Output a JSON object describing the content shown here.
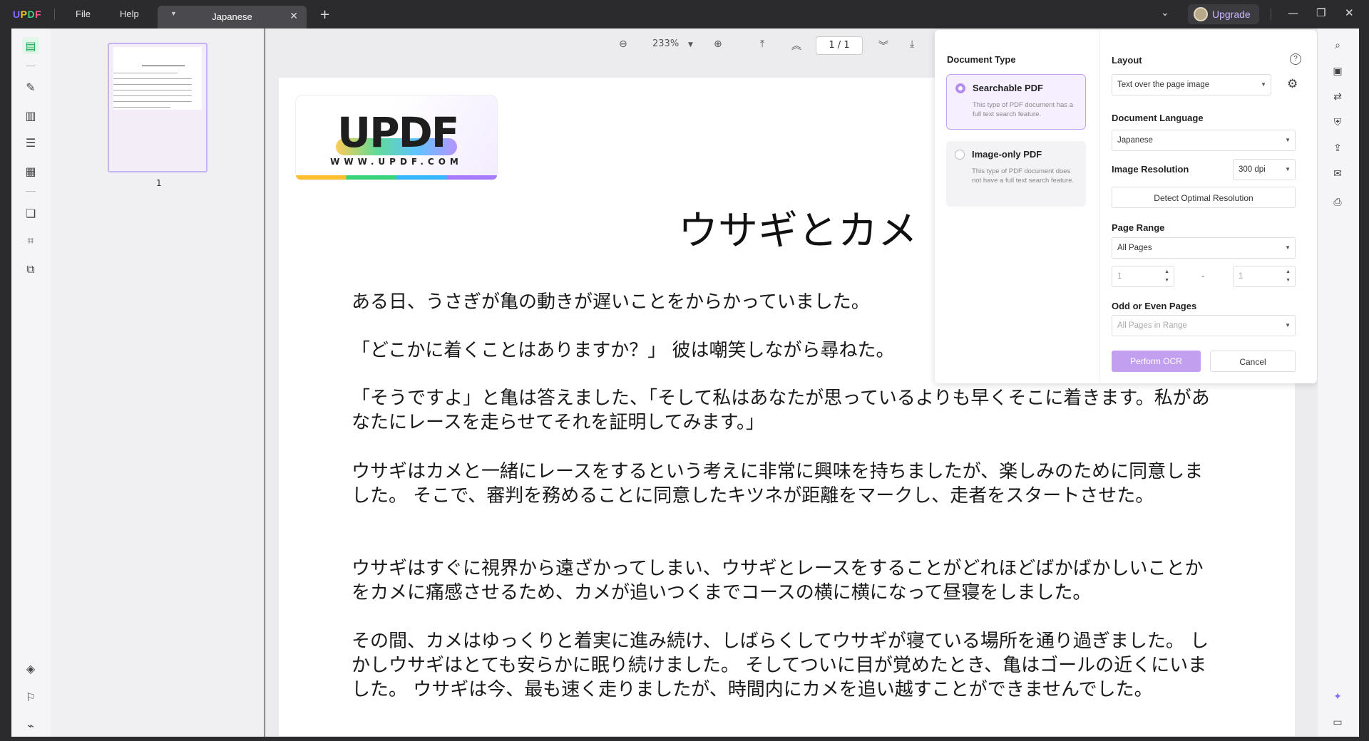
{
  "app": {
    "menu": {
      "file": "File",
      "help": "Help"
    },
    "tab": {
      "title": "Japanese"
    },
    "upgrade_label": "Upgrade"
  },
  "thumbnails": [
    {
      "page_label": "1"
    }
  ],
  "toolbar": {
    "zoom": "233%",
    "page_indicator": "1 / 1"
  },
  "document": {
    "logo_text": "UPDF",
    "logo_url_text": "WWW.UPDF.COM",
    "title": "ウサギとカメ",
    "paragraphs": [
      "ある日、うさぎが亀の動きが遅いことをからかっていました。",
      "「どこかに着くことはありますか？」 彼は嘲笑しながら尋ねた。",
      "「そうですよ」と亀は答えました、「そして私はあなたが思っているよりも早くそこに着きます。私があなたにレースを走らせてそれを証明してみます。」",
      "ウサギはカメと一緒にレースをするという考えに非常に興味を持ちましたが、楽しみのために同意しました。 そこで、審判を務めることに同意したキツネが距離をマークし、走者をスタートさせた。",
      "ウサギはすぐに視界から遠ざかってしまい、ウサギとレースをすることがどれほどばかばかしいことかをカメに痛感させるため、カメが追いつくまでコースの横に横になって昼寝をしました。",
      "その間、カメはゆっくりと着実に進み続け、しばらくしてウサギが寝ている場所を通り過ぎました。 しかしウサギはとても安らかに眠り続けました。 そしてついに目が覚めたとき、亀はゴールの近くにいました。 ウサギは今、最も速く走りましたが、時間内にカメを追い越すことができませんでした。"
    ]
  },
  "ocr_panel": {
    "document_type_heading": "Document Type",
    "options": [
      {
        "title": "Searchable PDF",
        "description": "This type of PDF document has a full text search feature.",
        "selected": true
      },
      {
        "title": "Image-only PDF",
        "description": "This type of PDF document does not have a full text search feature.",
        "selected": false
      }
    ],
    "layout_heading": "Layout",
    "layout_value": "Text over the page image",
    "language_heading": "Document Language",
    "language_value": "Japanese",
    "resolution_heading": "Image Resolution",
    "resolution_value": "300 dpi",
    "detect_button": "Detect Optimal Resolution",
    "page_range_heading": "Page Range",
    "page_range_value": "All Pages",
    "range_from": "1",
    "range_to": "1",
    "range_dash": "-",
    "odd_even_heading": "Odd or Even Pages",
    "odd_even_value": "All Pages in Range",
    "perform_button": "Perform OCR",
    "cancel_button": "Cancel"
  },
  "colors": {
    "accent": "#c2a0ef",
    "active_green": "#1aa653"
  }
}
